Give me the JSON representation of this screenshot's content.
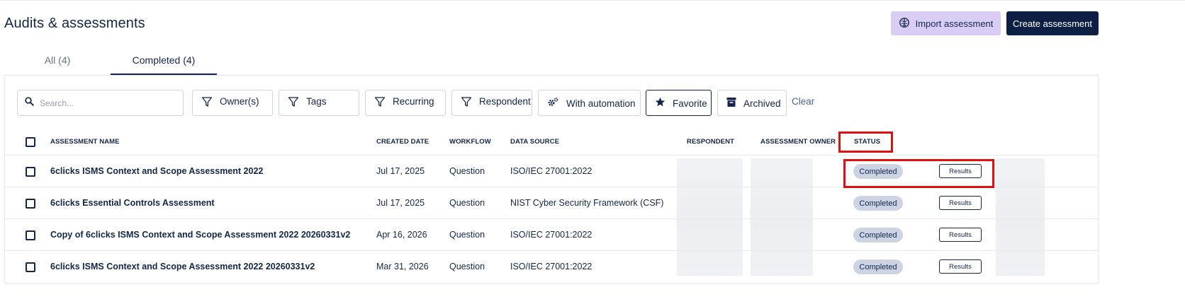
{
  "page": {
    "title": "Audits & assessments",
    "import_label": "Import assessment",
    "create_label": "Create assessment"
  },
  "tabs": [
    {
      "label": "All (4)"
    },
    {
      "label": "Completed (4)"
    }
  ],
  "filters": {
    "search_placeholder": "Search...",
    "owners": "Owner(s)",
    "tags": "Tags",
    "recurring": "Recurring",
    "respondent": "Respondent",
    "with_automation": "With automation",
    "favorite": "Favorite",
    "archived": "Archived",
    "clear": "Clear"
  },
  "table": {
    "columns": [
      "ASSESSMENT NAME",
      "CREATED DATE",
      "WORKFLOW",
      "DATA SOURCE",
      "RESPONDENT",
      "ASSESSMENT OWNER",
      "STATUS"
    ],
    "results_label": "Results",
    "rows": [
      {
        "name": "6clicks ISMS Context and Scope Assessment 2022",
        "created": "Jul 17, 2025",
        "workflow": "Question",
        "source": "ISO/IEC 27001:2022",
        "status": "Completed"
      },
      {
        "name": "6clicks Essential Controls Assessment",
        "created": "Jul 17, 2025",
        "workflow": "Question",
        "source": "NIST Cyber Security Framework (CSF)",
        "status": "Completed"
      },
      {
        "name": "Copy of 6clicks ISMS Context and Scope Assessment 2022 20260331v2",
        "created": "Apr 16, 2026",
        "workflow": "Question",
        "source": "ISO/IEC 27001:2022",
        "status": "Completed"
      },
      {
        "name": "6clicks ISMS Context and Scope Assessment 2022 20260331v2",
        "created": "Mar 31, 2026",
        "workflow": "Question",
        "source": "ISO/IEC 27001:2022",
        "status": "Completed"
      }
    ]
  },
  "icons": {
    "import": "brain-icon",
    "search": "search-icon",
    "filter": "filter-icon",
    "automation": "gears-icon",
    "favorite": "star-icon",
    "archived": "archive-box-icon"
  },
  "colors": {
    "primary": "#0d1f44",
    "import_bg": "#d9cdf6",
    "badge_bg": "#ccd4e3",
    "highlight": "#e01010",
    "link": "#4a64a8"
  }
}
